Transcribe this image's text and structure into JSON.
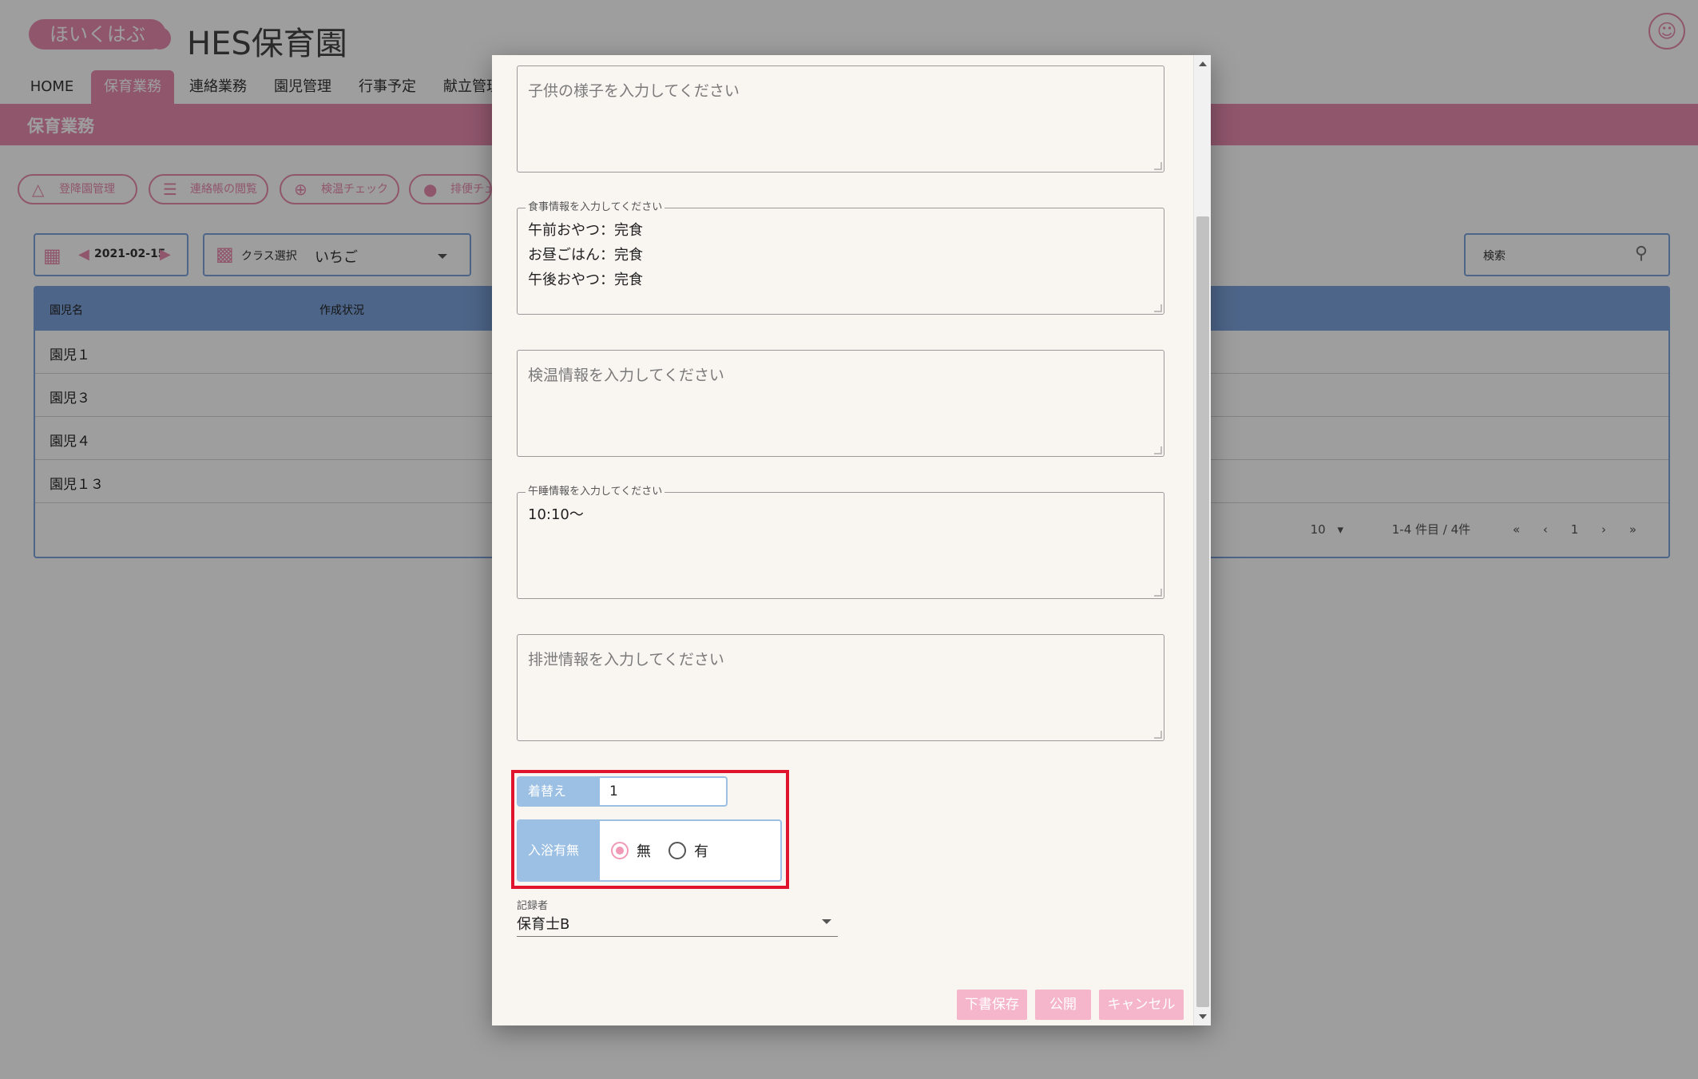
{
  "header": {
    "logo_text": "ほいくはぶ",
    "title": "HES保育園",
    "user_icon": "user-icon"
  },
  "nav": {
    "tabs": [
      "HOME",
      "保育業務",
      "連絡業務",
      "園児管理",
      "行事予定",
      "献立管理"
    ],
    "active": "保育業務"
  },
  "section_title": "保育業務",
  "toolbar": {
    "pills": [
      "登降園管理",
      "連絡帳の閲覧",
      "検温チェック",
      "排便チェ"
    ]
  },
  "filters": {
    "date": "2021-02-15",
    "class_label": "クラス選択",
    "class_value": "いちご",
    "search_label": "検索"
  },
  "table": {
    "headers": [
      "園児名",
      "作成状況"
    ],
    "rows": [
      "園児１",
      "園児３",
      "園児４",
      "園児１３"
    ],
    "pager": {
      "per_page": "10",
      "range": "1-4 件目 / 4件",
      "page": "1"
    }
  },
  "modal": {
    "child_state": {
      "placeholder": "子供の様子を入力してください",
      "value": ""
    },
    "meal": {
      "legend": "食事情報を入力してください",
      "lines": [
        "午前おやつ：完食",
        "お昼ごはん：完食",
        "午後おやつ：完食"
      ]
    },
    "temperature": {
      "placeholder": "検温情報を入力してください",
      "value": ""
    },
    "nap": {
      "legend": "午睡情報を入力してください",
      "lines": [
        "10:10〜"
      ]
    },
    "excretion": {
      "placeholder": "排泄情報を入力してください",
      "value": ""
    },
    "change_clothes": {
      "label": "着替え",
      "value": "1"
    },
    "bath": {
      "label": "入浴有無",
      "options": [
        "無",
        "有"
      ],
      "selected": "無"
    },
    "recorder": {
      "label": "記録者",
      "value": "保育士B"
    },
    "buttons": {
      "draft": "下書保存",
      "publish": "公開",
      "cancel": "キャンセル"
    }
  },
  "colors": {
    "brand_pink": "#e98cae",
    "table_blue": "#7da4dc",
    "label_blue": "#9cc0e4",
    "highlight_red": "#e0142c",
    "button_pink": "#f5b6cc"
  }
}
